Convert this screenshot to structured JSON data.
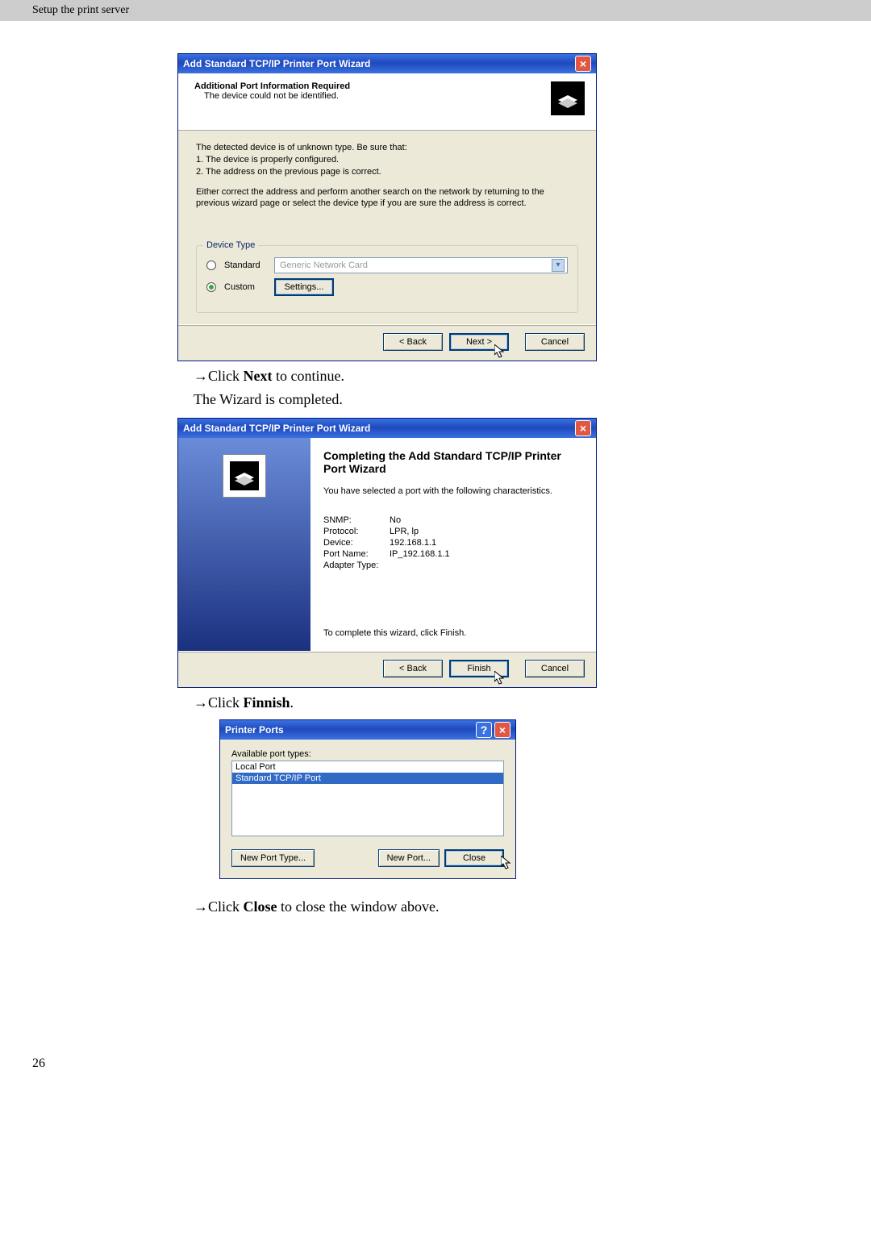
{
  "header": {
    "title": "Setup the print server"
  },
  "page_number": "26",
  "instructions": {
    "i1_prefix": "→Click ",
    "i1_bold": "Next",
    "i1_suffix": " to continue.",
    "i2": "The Wizard is completed.",
    "i3_prefix": "→Click ",
    "i3_bold": "Finnish",
    "i3_suffix": ".",
    "i4_prefix": "→Click ",
    "i4_bold": "Close",
    "i4_suffix": " to close the window above."
  },
  "dialog1": {
    "title": "Add Standard TCP/IP Printer Port Wizard",
    "heading": "Additional Port Information Required",
    "subheading": "The device could not be identified.",
    "body_line1": "The detected device is of unknown type.  Be sure that:",
    "body_line2": "1. The device is properly configured.",
    "body_line3": "2.  The address on the previous page is correct.",
    "body_para2": "Either correct the address and perform another search on the network by returning to the previous wizard page or select the device type if you are sure the address is correct.",
    "group_legend": "Device Type",
    "radio_standard": "Standard",
    "radio_custom": "Custom",
    "dropdown_value": "Generic Network Card",
    "btn_settings": "Settings...",
    "btn_back": "< Back",
    "btn_next": "Next >",
    "btn_cancel": "Cancel",
    "selected_radio": "custom"
  },
  "dialog2": {
    "title": "Add Standard TCP/IP Printer Port Wizard",
    "big_title": "Completing the Add Standard TCP/IP Printer Port Wizard",
    "intro": "You have selected a port with the following characteristics.",
    "rows": [
      {
        "k": "SNMP:",
        "v": "No"
      },
      {
        "k": "Protocol:",
        "v": "LPR, lp"
      },
      {
        "k": "Device:",
        "v": "192.168.1.1"
      },
      {
        "k": "Port Name:",
        "v": "IP_192.168.1.1"
      },
      {
        "k": "Adapter Type:",
        "v": ""
      }
    ],
    "finish_hint": "To complete this wizard, click Finish.",
    "btn_back": "< Back",
    "btn_finish": "Finish",
    "btn_cancel": "Cancel"
  },
  "dialog3": {
    "title": "Printer Ports",
    "label": "Available port types:",
    "items": [
      {
        "text": "Local Port",
        "selected": false
      },
      {
        "text": "Standard TCP/IP Port",
        "selected": true
      }
    ],
    "btn_new_type": "New Port Type...",
    "btn_new_port": "New Port...",
    "btn_close": "Close"
  }
}
